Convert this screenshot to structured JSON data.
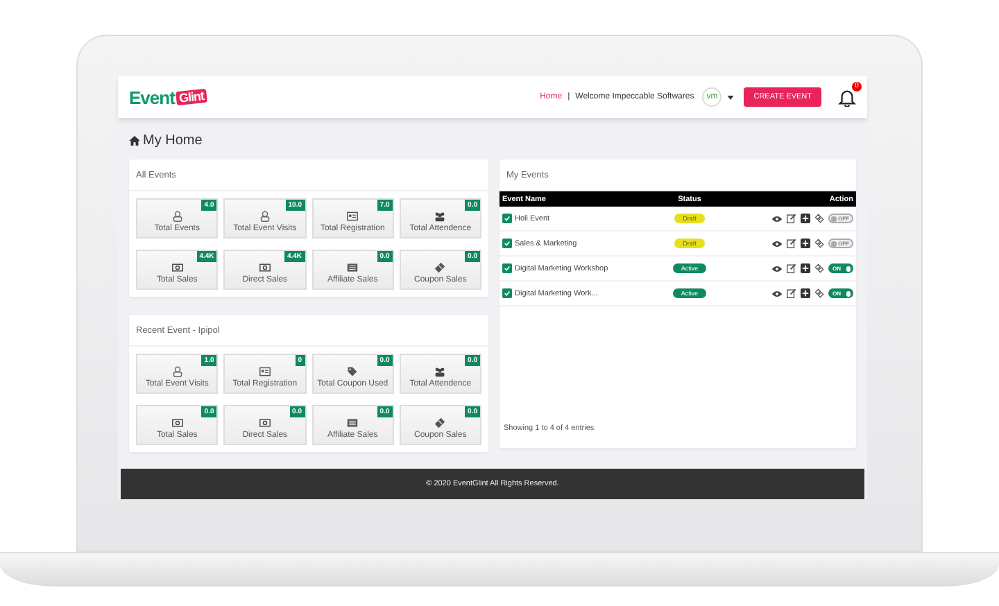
{
  "header": {
    "logo": {
      "main": "Event",
      "accent": "Glint"
    },
    "nav": {
      "link": "Home",
      "separator": "|",
      "welcome": "Welcome Impeccable Softwares",
      "avatar": "vm"
    },
    "create_button": "CREATE EVENT",
    "notifications": "0"
  },
  "page_title": "My Home",
  "stat_panels": [
    {
      "title": "All Events",
      "tiles": [
        {
          "label": "Total Events",
          "value": "4.0",
          "kind": "user"
        },
        {
          "label": "Total Event Visits",
          "value": "10.0",
          "kind": "user"
        },
        {
          "label": "Total Registration",
          "value": "7.0",
          "kind": "card"
        },
        {
          "label": "Total Attendence",
          "value": "0.0",
          "kind": "group"
        },
        {
          "label": "Total Sales",
          "value": "4.4K",
          "kind": "money"
        },
        {
          "label": "Direct Sales",
          "value": "4.4K",
          "kind": "money"
        },
        {
          "label": "Affiliate Sales",
          "value": "0.0",
          "kind": "list"
        },
        {
          "label": "Coupon Sales",
          "value": "0.0",
          "kind": "ticket"
        }
      ]
    },
    {
      "title": "Recent Event - Ipipol",
      "tiles": [
        {
          "label": "Total Event Visits",
          "value": "1.0",
          "kind": "user"
        },
        {
          "label": "Total Registration",
          "value": "0",
          "kind": "card"
        },
        {
          "label": "Total Coupon Used",
          "value": "0.0",
          "kind": "tag"
        },
        {
          "label": "Total Attendence",
          "value": "0.0",
          "kind": "group"
        },
        {
          "label": "Total Sales",
          "value": "0.0",
          "kind": "money"
        },
        {
          "label": "Direct Sales",
          "value": "0.0",
          "kind": "money"
        },
        {
          "label": "Affiliate Sales",
          "value": "0.0",
          "kind": "list"
        },
        {
          "label": "Coupon Sales",
          "value": "0.0",
          "kind": "ticket"
        }
      ]
    }
  ],
  "my_events": {
    "title": "My Events",
    "columns": [
      "Event Name",
      "Status",
      "Action"
    ],
    "rows": [
      {
        "name": "Holi Event",
        "checked": true,
        "status": "Draft",
        "kind": "draft",
        "toggle": "OFF",
        "on": false
      },
      {
        "name": "Sales & Marketing",
        "checked": true,
        "status": "Draft",
        "kind": "draft",
        "toggle": "OFF",
        "on": false
      },
      {
        "name": "Digital Marketing Workshop",
        "checked": true,
        "status": "Active",
        "kind": "active",
        "toggle": "ON",
        "on": true
      },
      {
        "name": "Digital Marketing Work...",
        "checked": true,
        "status": "Active",
        "kind": "active",
        "toggle": "ON",
        "on": true
      }
    ],
    "entries": "Showing 1 to 4 of 4 entries"
  },
  "footer": "© 2020 EventGlint All Rights Reserved."
}
